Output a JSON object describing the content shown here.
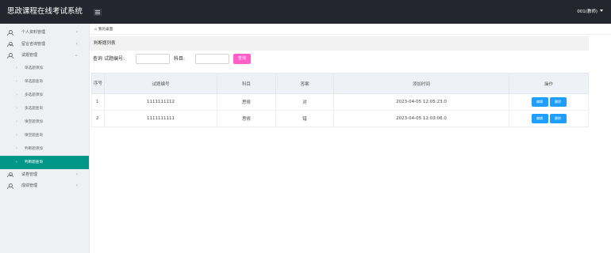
{
  "app": {
    "title": "思政课程在线考试系统",
    "user": "001(教师)"
  },
  "sidebar": {
    "items": [
      {
        "label": "个人资料管理",
        "expanded": false
      },
      {
        "label": "留言咨询管理",
        "expanded": false
      },
      {
        "label": "试题管理",
        "expanded": true,
        "children": [
          "单选题添加",
          "单选题查询",
          "多选题添加",
          "多选题查询",
          "填空题添加",
          "填空题查询",
          "判断题添加",
          "判断题查询"
        ],
        "active_child": "判断题查询"
      },
      {
        "label": "试卷管理",
        "expanded": false
      },
      {
        "label": "成绩管理",
        "expanded": false
      }
    ]
  },
  "tabs": {
    "current": "我的桌面"
  },
  "main": {
    "title": "判断题列表",
    "search": {
      "label_query": "查询",
      "label_code": "试题编号:",
      "label_subject": "科目:",
      "code_value": "",
      "subject_value": "",
      "button": "查询",
      "button_color": "#ff5fc9"
    },
    "table": {
      "headers": [
        "序号",
        "试题编号",
        "科目",
        "答案",
        "添加时间",
        "操作"
      ],
      "rows": [
        {
          "seq": "1",
          "code": "1111111112",
          "subject": "思修",
          "answer": "对",
          "time": "2023-04-05 12:05:23.0"
        },
        {
          "seq": "2",
          "code": "1111111111",
          "subject": "思修",
          "answer": "错",
          "time": "2023-04-05 12:03:06.0"
        }
      ],
      "actions": {
        "edit": "编辑",
        "delete": "删除"
      }
    }
  },
  "colors": {
    "topbar": "#23262e",
    "active": "#009688",
    "action_button": "#1e9fff"
  }
}
